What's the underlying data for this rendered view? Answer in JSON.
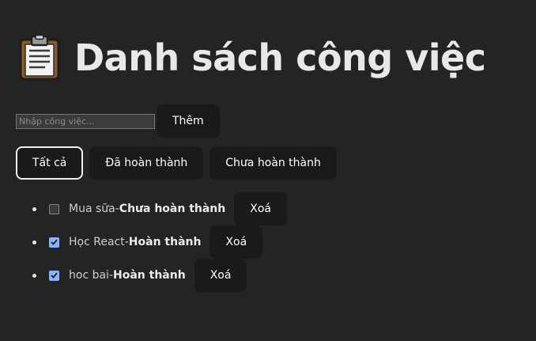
{
  "header": {
    "title": "Danh sách công việc",
    "icon": "clipboard-icon"
  },
  "add_form": {
    "placeholder": "Nhập công việc...",
    "value": "",
    "add_label": "Thêm"
  },
  "filters": [
    {
      "label": "Tất cả",
      "active": true
    },
    {
      "label": "Đã hoàn thành",
      "active": false
    },
    {
      "label": "Chưa hoàn thành",
      "active": false
    }
  ],
  "todos": [
    {
      "name": "Mua sữa",
      "separator": " -",
      "status": "Chưa hoàn thành",
      "checked": false,
      "delete_label": "Xoá"
    },
    {
      "name": "Học React",
      "separator": " -",
      "status": "Hoàn thành",
      "checked": true,
      "delete_label": "Xoá"
    },
    {
      "name": "hoc bai",
      "separator": " -",
      "status": "Hoàn thành",
      "checked": true,
      "delete_label": "Xoá"
    }
  ],
  "colors": {
    "background": "#242424",
    "button": "#1a1a1a",
    "checkbox_checked": "#8ab4f8"
  }
}
